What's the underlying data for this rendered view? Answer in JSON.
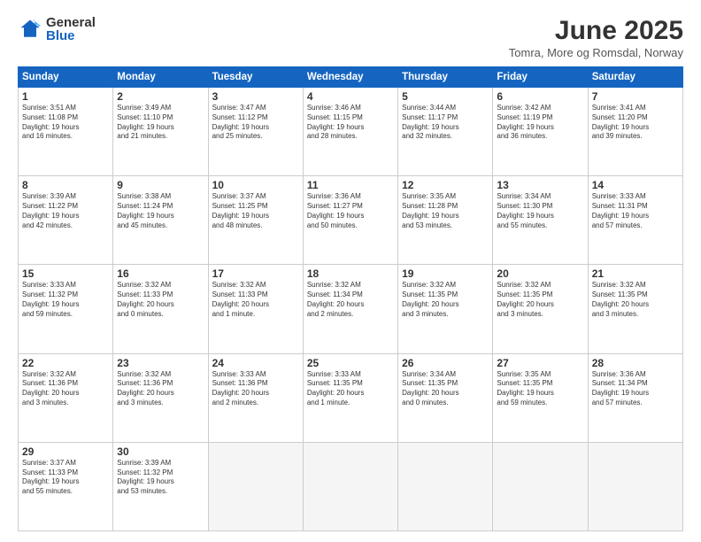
{
  "logo": {
    "general": "General",
    "blue": "Blue"
  },
  "title": "June 2025",
  "location": "Tomra, More og Romsdal, Norway",
  "headers": [
    "Sunday",
    "Monday",
    "Tuesday",
    "Wednesday",
    "Thursday",
    "Friday",
    "Saturday"
  ],
  "weeks": [
    [
      {
        "day": "1",
        "info": "Sunrise: 3:51 AM\nSunset: 11:08 PM\nDaylight: 19 hours\nand 16 minutes."
      },
      {
        "day": "2",
        "info": "Sunrise: 3:49 AM\nSunset: 11:10 PM\nDaylight: 19 hours\nand 21 minutes."
      },
      {
        "day": "3",
        "info": "Sunrise: 3:47 AM\nSunset: 11:12 PM\nDaylight: 19 hours\nand 25 minutes."
      },
      {
        "day": "4",
        "info": "Sunrise: 3:46 AM\nSunset: 11:15 PM\nDaylight: 19 hours\nand 28 minutes."
      },
      {
        "day": "5",
        "info": "Sunrise: 3:44 AM\nSunset: 11:17 PM\nDaylight: 19 hours\nand 32 minutes."
      },
      {
        "day": "6",
        "info": "Sunrise: 3:42 AM\nSunset: 11:19 PM\nDaylight: 19 hours\nand 36 minutes."
      },
      {
        "day": "7",
        "info": "Sunrise: 3:41 AM\nSunset: 11:20 PM\nDaylight: 19 hours\nand 39 minutes."
      }
    ],
    [
      {
        "day": "8",
        "info": "Sunrise: 3:39 AM\nSunset: 11:22 PM\nDaylight: 19 hours\nand 42 minutes."
      },
      {
        "day": "9",
        "info": "Sunrise: 3:38 AM\nSunset: 11:24 PM\nDaylight: 19 hours\nand 45 minutes."
      },
      {
        "day": "10",
        "info": "Sunrise: 3:37 AM\nSunset: 11:25 PM\nDaylight: 19 hours\nand 48 minutes."
      },
      {
        "day": "11",
        "info": "Sunrise: 3:36 AM\nSunset: 11:27 PM\nDaylight: 19 hours\nand 50 minutes."
      },
      {
        "day": "12",
        "info": "Sunrise: 3:35 AM\nSunset: 11:28 PM\nDaylight: 19 hours\nand 53 minutes."
      },
      {
        "day": "13",
        "info": "Sunrise: 3:34 AM\nSunset: 11:30 PM\nDaylight: 19 hours\nand 55 minutes."
      },
      {
        "day": "14",
        "info": "Sunrise: 3:33 AM\nSunset: 11:31 PM\nDaylight: 19 hours\nand 57 minutes."
      }
    ],
    [
      {
        "day": "15",
        "info": "Sunrise: 3:33 AM\nSunset: 11:32 PM\nDaylight: 19 hours\nand 59 minutes."
      },
      {
        "day": "16",
        "info": "Sunrise: 3:32 AM\nSunset: 11:33 PM\nDaylight: 20 hours\nand 0 minutes."
      },
      {
        "day": "17",
        "info": "Sunrise: 3:32 AM\nSunset: 11:33 PM\nDaylight: 20 hours\nand 1 minute."
      },
      {
        "day": "18",
        "info": "Sunrise: 3:32 AM\nSunset: 11:34 PM\nDaylight: 20 hours\nand 2 minutes."
      },
      {
        "day": "19",
        "info": "Sunrise: 3:32 AM\nSunset: 11:35 PM\nDaylight: 20 hours\nand 3 minutes."
      },
      {
        "day": "20",
        "info": "Sunrise: 3:32 AM\nSunset: 11:35 PM\nDaylight: 20 hours\nand 3 minutes."
      },
      {
        "day": "21",
        "info": "Sunrise: 3:32 AM\nSunset: 11:35 PM\nDaylight: 20 hours\nand 3 minutes."
      }
    ],
    [
      {
        "day": "22",
        "info": "Sunrise: 3:32 AM\nSunset: 11:36 PM\nDaylight: 20 hours\nand 3 minutes."
      },
      {
        "day": "23",
        "info": "Sunrise: 3:32 AM\nSunset: 11:36 PM\nDaylight: 20 hours\nand 3 minutes."
      },
      {
        "day": "24",
        "info": "Sunrise: 3:33 AM\nSunset: 11:36 PM\nDaylight: 20 hours\nand 2 minutes."
      },
      {
        "day": "25",
        "info": "Sunrise: 3:33 AM\nSunset: 11:35 PM\nDaylight: 20 hours\nand 1 minute."
      },
      {
        "day": "26",
        "info": "Sunrise: 3:34 AM\nSunset: 11:35 PM\nDaylight: 20 hours\nand 0 minutes."
      },
      {
        "day": "27",
        "info": "Sunrise: 3:35 AM\nSunset: 11:35 PM\nDaylight: 19 hours\nand 59 minutes."
      },
      {
        "day": "28",
        "info": "Sunrise: 3:36 AM\nSunset: 11:34 PM\nDaylight: 19 hours\nand 57 minutes."
      }
    ],
    [
      {
        "day": "29",
        "info": "Sunrise: 3:37 AM\nSunset: 11:33 PM\nDaylight: 19 hours\nand 55 minutes."
      },
      {
        "day": "30",
        "info": "Sunrise: 3:39 AM\nSunset: 11:32 PM\nDaylight: 19 hours\nand 53 minutes."
      },
      {
        "day": "",
        "info": ""
      },
      {
        "day": "",
        "info": ""
      },
      {
        "day": "",
        "info": ""
      },
      {
        "day": "",
        "info": ""
      },
      {
        "day": "",
        "info": ""
      }
    ]
  ]
}
